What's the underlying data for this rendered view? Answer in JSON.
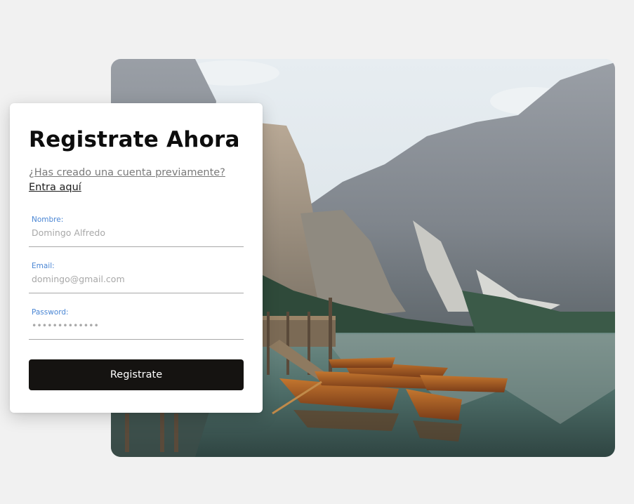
{
  "form": {
    "title": "Registrate Ahora",
    "login_question": "¿Has creado una cuenta previamente?",
    "login_link": "Entra aquí",
    "fields": [
      {
        "label": "Nombre:",
        "placeholder": "Domingo Alfredo",
        "type": "text"
      },
      {
        "label": "Email:",
        "placeholder": "domingo@gmail.com",
        "type": "email"
      },
      {
        "label": "Password:",
        "placeholder": "•••••••••••••",
        "type": "password"
      }
    ],
    "submit_label": "Registrate"
  },
  "colors": {
    "page_background": "#f1f1f1",
    "card_background": "#ffffff",
    "field_label": "#4a86d4",
    "button_background": "#151311",
    "button_text": "#ffffff"
  },
  "scene": {
    "subject": "mountain lake with wooden dock and rowboats"
  }
}
